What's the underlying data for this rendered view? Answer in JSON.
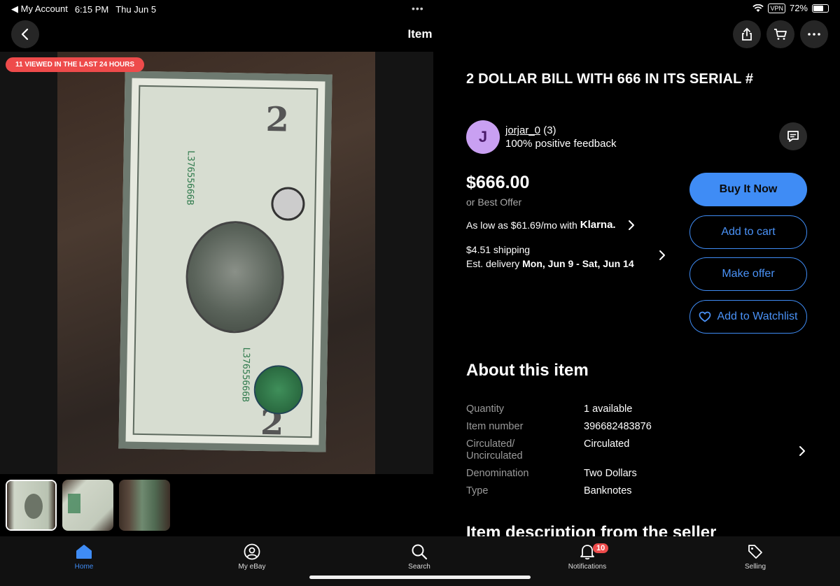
{
  "status_bar": {
    "back_app": "My Account",
    "time": "6:15 PM",
    "date": "Thu Jun 5",
    "vpn": "VPN",
    "battery": "72%",
    "battery_level": 0.72
  },
  "nav": {
    "title": "Item"
  },
  "gallery": {
    "viewed_badge": "11 VIEWED IN THE LAST 24 HOURS",
    "serial_number": "L37655666B",
    "thumbnail_count": 3
  },
  "item": {
    "title": "2 DOLLAR BILL WITH 666 IN ITS SERIAL #",
    "seller": {
      "avatar_letter": "J",
      "name": "jorjar_0",
      "score": "(3)",
      "feedback": "100% positive feedback"
    },
    "price": "$666.00",
    "best_offer": "or Best Offer",
    "klarna": {
      "text": "As low as $61.69/mo with",
      "brand": "Klarna."
    },
    "shipping": "$4.51 shipping",
    "delivery_prefix": "Est. delivery",
    "delivery_dates": "Mon, Jun 9 - Sat, Jun 14"
  },
  "actions": {
    "buy_now": "Buy It Now",
    "add_to_cart": "Add to cart",
    "make_offer": "Make offer",
    "watchlist": "Add to Watchlist"
  },
  "about": {
    "heading": "About this item",
    "specs": [
      {
        "key": "Quantity",
        "value": "1 available"
      },
      {
        "key": "Item number",
        "value": "396682483876"
      },
      {
        "key": "Circulated/\nUncirculated",
        "value": "Circulated"
      },
      {
        "key": "Denomination",
        "value": "Two Dollars"
      },
      {
        "key": "Type",
        "value": "Banknotes"
      }
    ],
    "description_heading": "Item description from the seller"
  },
  "tabbar": {
    "home": "Home",
    "my_ebay": "My eBay",
    "search": "Search",
    "notifications": "Notifications",
    "notifications_count": "10",
    "selling": "Selling"
  },
  "colors": {
    "accent": "#3f8cf5",
    "badge": "#ee4b4b",
    "avatar": "#c9a0f2"
  }
}
